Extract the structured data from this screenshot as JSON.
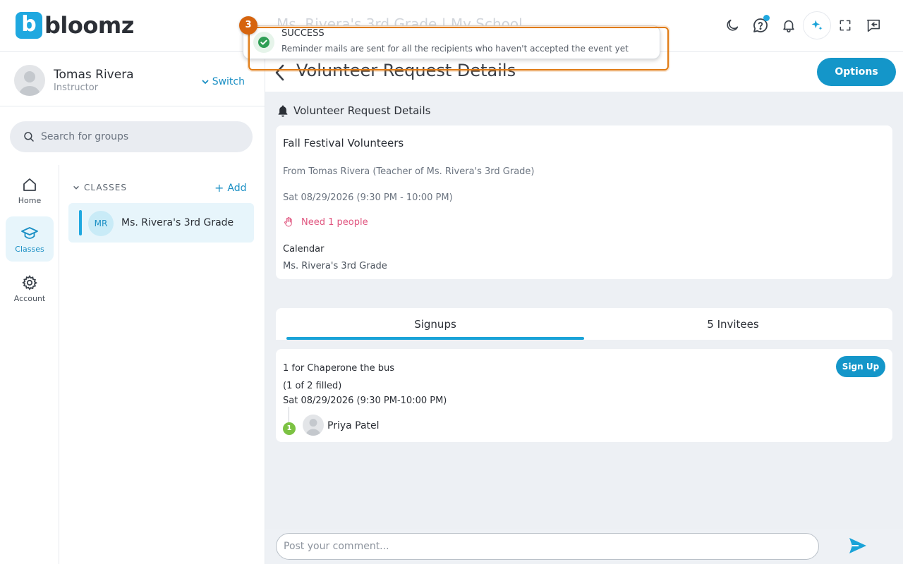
{
  "app": {
    "logo_text": "bloomz",
    "logo_letter": "b"
  },
  "header": {
    "ghost_title": "Ms. Rivera's 3rd Grade | My School"
  },
  "user": {
    "name": "Tomas Rivera",
    "role": "Instructor",
    "switch_label": "Switch"
  },
  "search": {
    "placeholder": "Search for groups"
  },
  "nav": {
    "home": "Home",
    "classes": "Classes",
    "account": "Account"
  },
  "classes_panel": {
    "heading": "CLASSES",
    "add_label": "Add",
    "items": [
      {
        "initials": "MR",
        "name": "Ms. Rivera's 3rd Grade"
      }
    ]
  },
  "page": {
    "title": "Volunteer Request Details",
    "options_label": "Options",
    "section_title": "Volunteer Request Details"
  },
  "event": {
    "title": "Fall Festival Volunteers",
    "from": "From Tomas Rivera (Teacher of Ms. Rivera's 3rd Grade)",
    "date": "Sat 08/29/2026 (9:30 PM - 10:00 PM)",
    "need": "Need 1 people",
    "calendar_label": "Calendar",
    "calendar_value": "Ms. Rivera's 3rd Grade"
  },
  "tabs": {
    "signups": "Signups",
    "invitees": "5 Invitees",
    "active": "signups"
  },
  "signup": {
    "task": "1 for Chaperone the bus",
    "filled": "(1 of 2 filled)",
    "time": "Sat 08/29/2026 (9:30 PM-10:00 PM)",
    "button": "Sign Up",
    "participants": [
      {
        "number": "1",
        "name": "Priya Patel"
      }
    ]
  },
  "comment": {
    "placeholder": "Post your comment..."
  },
  "toast": {
    "title": "SUCCESS",
    "message": "Reminder mails are sent for all the recipients who haven't accepted the event yet",
    "step_number": "3"
  },
  "colors": {
    "brand": "#1fa8e0",
    "primary_button": "#1496c9",
    "need_text": "#e0557f",
    "highlight": "#e07b14"
  }
}
